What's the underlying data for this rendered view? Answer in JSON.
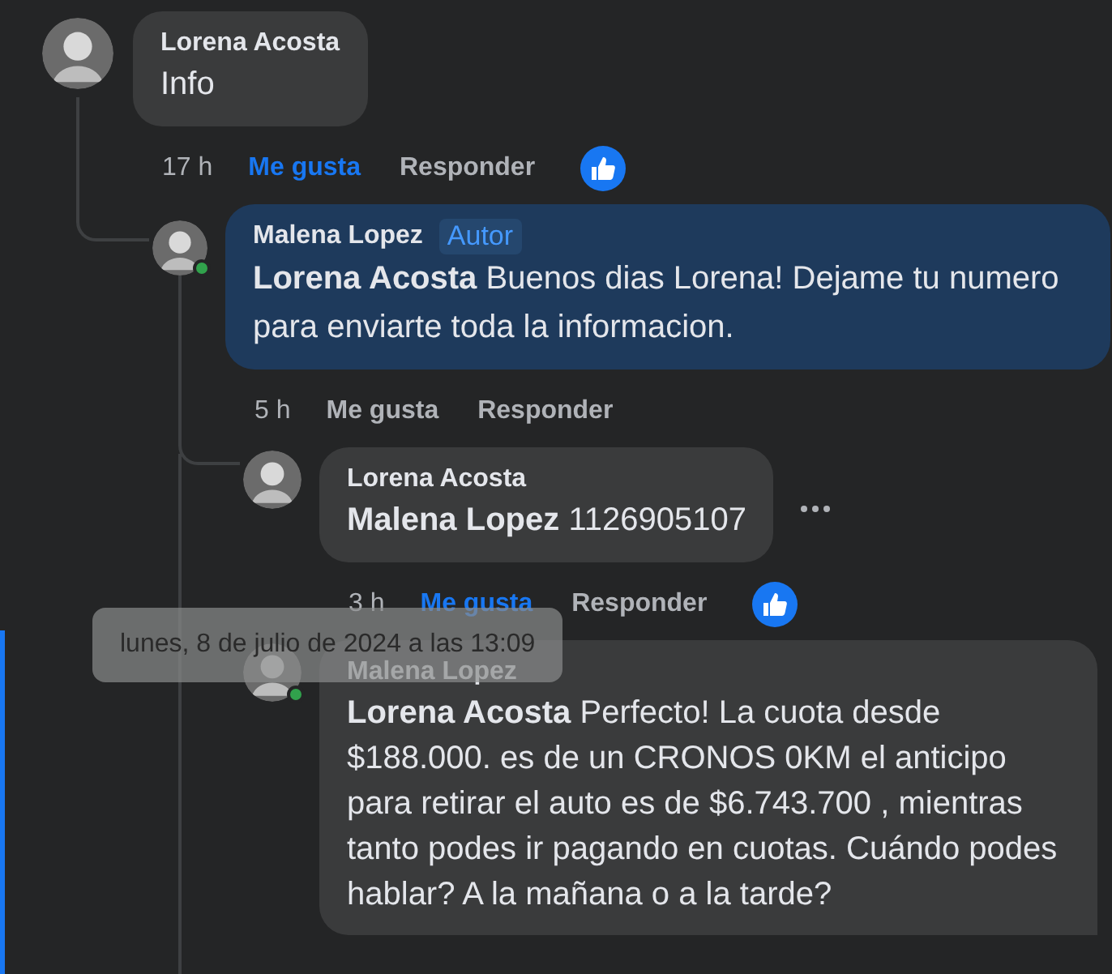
{
  "comments": [
    {
      "author": "Lorena Acosta",
      "online": false,
      "highlighted": false,
      "focused": false,
      "text": "Info",
      "time": "17 h",
      "like_label": "Me gusta",
      "liked": true,
      "reply_label": "Responder",
      "has_reaction": true,
      "menu_visible": false,
      "replies": [
        {
          "author": "Malena Lopez",
          "badge": "Autor",
          "online": true,
          "highlighted": true,
          "focused": false,
          "text": "**Lorena Acosta** Buenos dias Lorena! Dejame tu numero para enviarte toda la informacion.",
          "time": "5 h",
          "like_label": "Me gusta",
          "liked": false,
          "reply_label": "Responder",
          "has_reaction": false,
          "menu_visible": false,
          "replies": [
            {
              "author": "Lorena Acosta",
              "online": false,
              "highlighted": false,
              "focused": false,
              "text": "**Malena Lopez** 1126905107",
              "time": "3 h",
              "like_label": "Me gusta",
              "liked": true,
              "reply_label": "Responder",
              "has_reaction": true,
              "menu_visible": true
            },
            {
              "author": "Malena Lopez",
              "online": true,
              "highlighted": false,
              "focused": true,
              "text": "**Lorena Acosta** Perfecto! La cuota desde $188.000. es de un CRONOS 0KM el anticipo para retirar el auto es de $6.743.700 , mientras tanto podes ir pagando en cuotas. Cuándo podes hablar? A la mañana o a la tarde?"
            }
          ]
        }
      ]
    }
  ],
  "tooltip": {
    "text": "lunes, 8 de julio de 2024 a las 13:09"
  }
}
